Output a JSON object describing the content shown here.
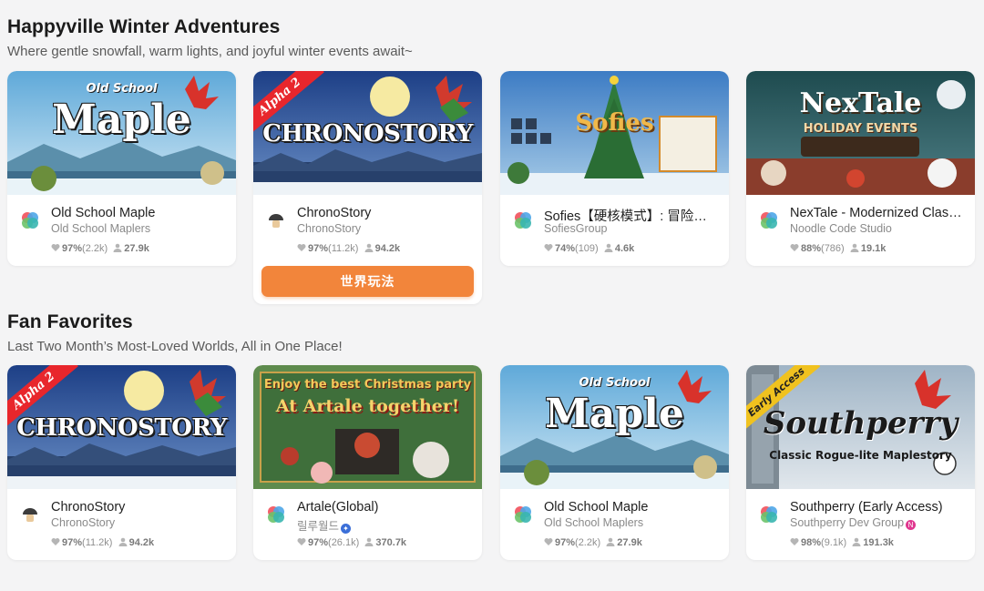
{
  "sections": [
    {
      "title": "Happyville Winter Adventures",
      "subtitle": "Where gentle snowfall, warm lights, and joyful winter events await~",
      "cards": [
        {
          "name": "Old School Maple",
          "developer": "Old School Maplers",
          "rating": "97%",
          "reviews": "(2.2k)",
          "players": "27.9k",
          "thumb_title": "Maple",
          "thumb_small": "Old School",
          "ribbon": ""
        },
        {
          "name": "ChronoStory",
          "developer": "ChronoStory",
          "rating": "97%",
          "reviews": "(11.2k)",
          "players": "94.2k",
          "thumb_title": "CHRONOSTORY",
          "thumb_small": "",
          "ribbon": "Alpha 2",
          "button": "世界玩法"
        },
        {
          "name": "Sofies【硬核模式】: 冒险…",
          "developer": "SofiesGroup",
          "rating": "74%",
          "reviews": "(109)",
          "players": "4.6k",
          "thumb_title": "Sofies",
          "thumb_small": "",
          "ribbon": ""
        },
        {
          "name": "NexTale - Modernized Clas…",
          "developer": "Noodle Code Studio",
          "rating": "88%",
          "reviews": "(786)",
          "players": "19.1k",
          "thumb_title": "NexTale",
          "thumb_small": "HOLIDAY EVENTS",
          "ribbon": ""
        }
      ]
    },
    {
      "title": "Fan Favorites",
      "subtitle": "Last Two Month’s Most-Loved Worlds, All in One Place!",
      "cards": [
        {
          "name": "ChronoStory",
          "developer": "ChronoStory",
          "rating": "97%",
          "reviews": "(11.2k)",
          "players": "94.2k",
          "thumb_title": "CHRONOSTORY",
          "thumb_small": "",
          "ribbon": "Alpha 2"
        },
        {
          "name": "Artale(Global)",
          "developer": "릴루월드",
          "rating": "97%",
          "reviews": "(26.1k)",
          "players": "370.7k",
          "thumb_title": "At Artale together!",
          "thumb_small": "Enjoy the best Christmas party",
          "ribbon": ""
        },
        {
          "name": "Old School Maple",
          "developer": "Old School Maplers",
          "rating": "97%",
          "reviews": "(2.2k)",
          "players": "27.9k",
          "thumb_title": "Maple",
          "thumb_small": "Old School",
          "ribbon": ""
        },
        {
          "name": "Southperry (Early Access)",
          "developer": "Southperry Dev Group",
          "rating": "98%",
          "reviews": "(9.1k)",
          "players": "191.3k",
          "thumb_title": "Southperry",
          "thumb_small": "Classic Rogue-lite Maplestory",
          "ribbon": "Early Access"
        }
      ]
    }
  ],
  "colors": {
    "accent": "#f2853b",
    "background": "#f4f4f5",
    "card": "#ffffff"
  }
}
